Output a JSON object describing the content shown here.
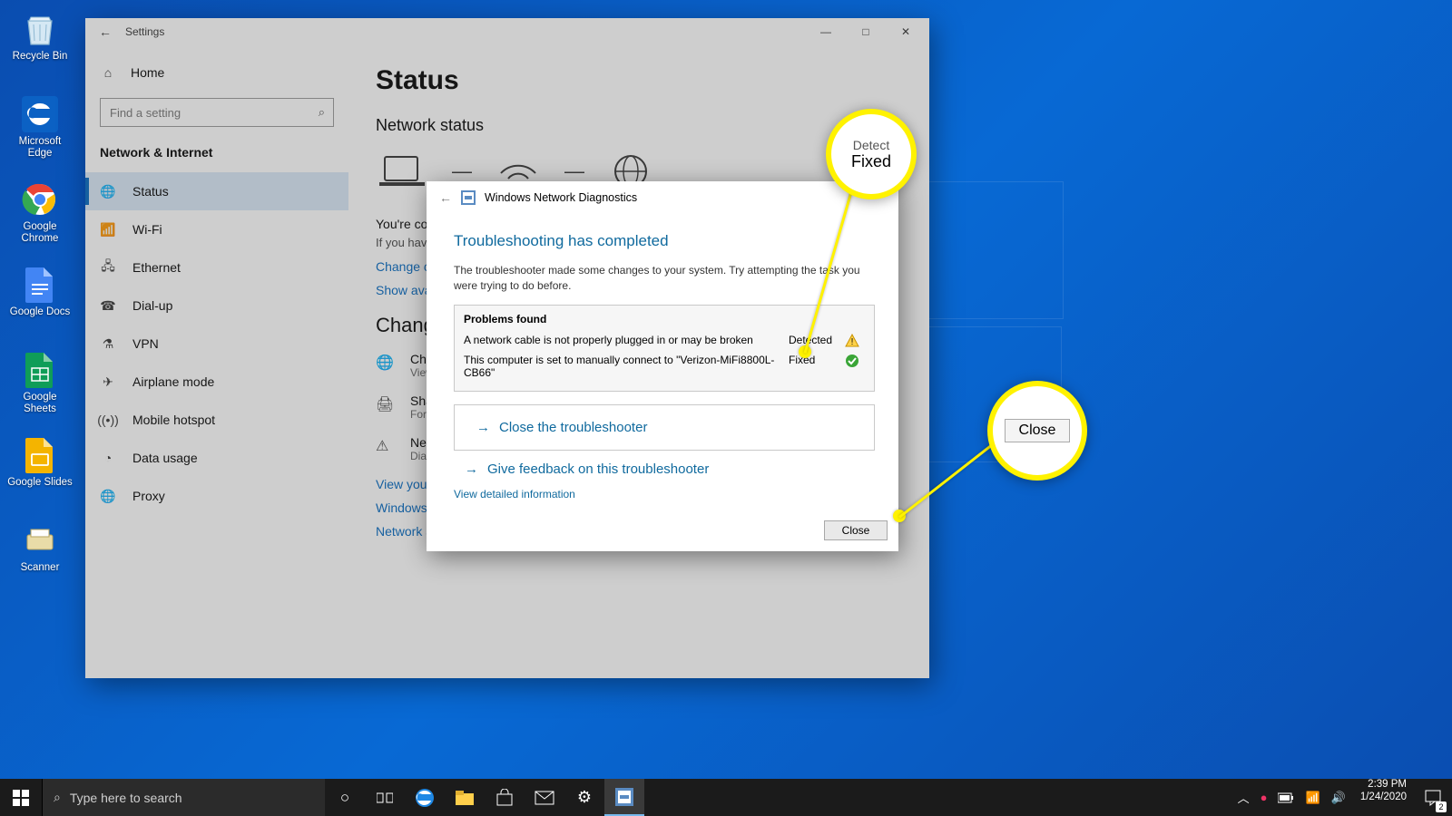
{
  "desktop": {
    "icons": [
      {
        "name": "recycle-bin",
        "label": "Recycle Bin"
      },
      {
        "name": "microsoft-edge",
        "label": "Microsoft Edge"
      },
      {
        "name": "google-chrome",
        "label": "Google Chrome"
      },
      {
        "name": "google-docs",
        "label": "Google Docs"
      },
      {
        "name": "google-sheets",
        "label": "Google Sheets"
      },
      {
        "name": "google-slides",
        "label": "Google Slides"
      },
      {
        "name": "scanner",
        "label": "Scanner"
      }
    ]
  },
  "settings": {
    "title": "Settings",
    "home": "Home",
    "search_placeholder": "Find a setting",
    "category": "Network & Internet",
    "nav": [
      {
        "icon": "status-icon",
        "label": "Status",
        "selected": true
      },
      {
        "icon": "wifi-icon",
        "label": "Wi-Fi"
      },
      {
        "icon": "ethernet-icon",
        "label": "Ethernet"
      },
      {
        "icon": "dialup-icon",
        "label": "Dial-up"
      },
      {
        "icon": "vpn-icon",
        "label": "VPN"
      },
      {
        "icon": "airplane-icon",
        "label": "Airplane mode"
      },
      {
        "icon": "hotspot-icon",
        "label": "Mobile hotspot"
      },
      {
        "icon": "datausage-icon",
        "label": "Data usage"
      },
      {
        "icon": "proxy-icon",
        "label": "Proxy"
      }
    ],
    "main": {
      "h1": "Status",
      "h2": "Network status",
      "connected_title": "You're co",
      "connected_body": "If you have\nmetered co",
      "change_link": "Change co",
      "show_link": "Show avail",
      "h3": "Change",
      "rows": [
        {
          "title": "Chan",
          "sub": "View n"
        },
        {
          "title": "Shari",
          "sub": "For th"
        },
        {
          "title": "Network troubleshooter",
          "sub": "Diagnose and fix network problems."
        }
      ],
      "links": [
        "View your network properties",
        "Windows Firewall",
        "Network and Sharing Center"
      ]
    }
  },
  "dialog": {
    "app": "Windows Network Diagnostics",
    "title": "Troubleshooting has completed",
    "sub": "The troubleshooter made some changes to your system. Try attempting the task you were trying to do before.",
    "problems_header": "Problems found",
    "problems": [
      {
        "text": "A network cable is not properly plugged in or may be broken",
        "status": "Detected",
        "icon": "warning"
      },
      {
        "text": "This computer is set to manually connect to \"Verizon-MiFi8800L-CB66\"",
        "status": "Fixed",
        "icon": "check"
      }
    ],
    "close_ts": "Close the troubleshooter",
    "feedback": "Give feedback on this troubleshooter",
    "view_detail": "View detailed information",
    "close": "Close"
  },
  "callouts": {
    "fixed_top": "Detect",
    "fixed_main": "Fixed",
    "close": "Close"
  },
  "taskbar": {
    "search_placeholder": "Type here to search",
    "time": "2:39 PM",
    "date": "1/24/2020",
    "notif_count": "2"
  }
}
